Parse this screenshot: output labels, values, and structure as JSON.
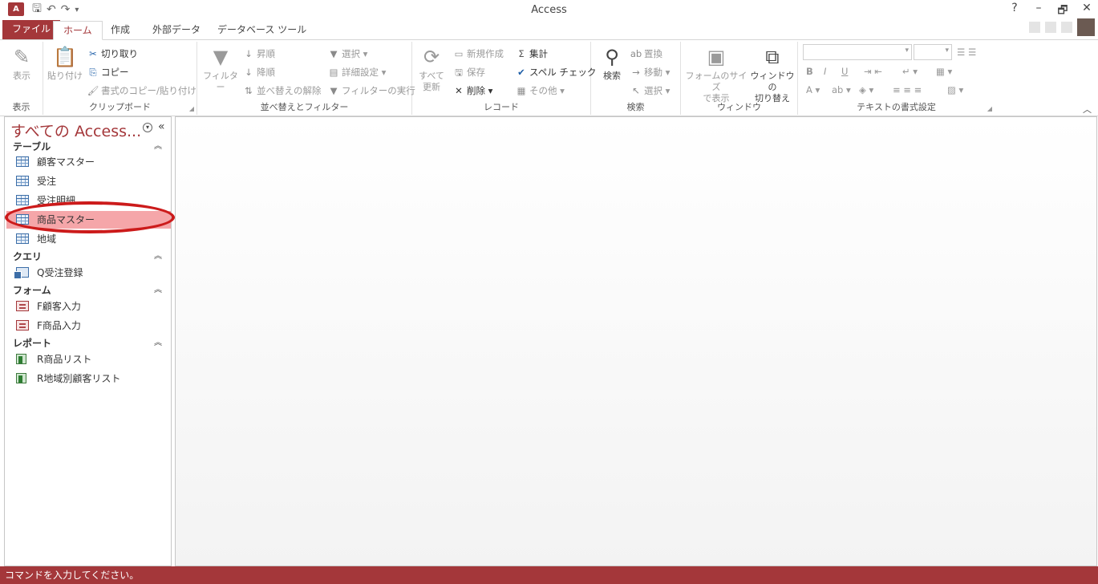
{
  "app": {
    "icon_label": "A",
    "window_title": "Access",
    "qat": {
      "save": "🖫",
      "undo": "↶",
      "redo": "↷",
      "customize": "▾"
    },
    "window_controls": {
      "help": "?",
      "minimize": "–",
      "restore": "🗗",
      "close": "✕"
    }
  },
  "tabs": {
    "file": "ファイル",
    "home": "ホーム",
    "create": "作成",
    "external": "外部データ",
    "dbtools": "データベース ツール"
  },
  "ribbon": {
    "views": {
      "label": "表示",
      "view_button": "表示"
    },
    "clipboard": {
      "label": "クリップボード",
      "paste": "貼り付け",
      "cut": "切り取り",
      "copy": "コピー",
      "format_painter": "書式のコピー/貼り付け"
    },
    "sort_filter": {
      "label": "並べ替えとフィルター",
      "filter": "フィルター",
      "ascending": "昇順",
      "descending": "降順",
      "clear_sort": "並べ替えの解除",
      "selection": "選択",
      "advanced": "詳細設定",
      "toggle_filter": "フィルターの実行"
    },
    "records": {
      "label": "レコード",
      "refresh_line1": "すべて",
      "refresh_line2": "更新",
      "new": "新規作成",
      "save": "保存",
      "delete": "削除",
      "totals": "集計",
      "spelling": "スペル チェック",
      "more": "その他"
    },
    "find": {
      "label": "検索",
      "find": "検索",
      "replace": "置換",
      "goto": "移動",
      "select": "選択"
    },
    "window": {
      "label": "ウィンドウ",
      "fit_form_line1": "フォームのサイズ",
      "fit_form_line2": "で表示",
      "switch_line1": "ウィンドウの",
      "switch_line2": "切り替え"
    },
    "text_format": {
      "label": "テキストの書式設定",
      "bold": "B",
      "italic": "I",
      "underline": "U",
      "font_color": "A"
    }
  },
  "nav": {
    "title": "すべての Access...",
    "menu_icon": "▾",
    "shutter": "«",
    "groups": [
      {
        "header": "テーブル",
        "items": [
          "顧客マスター",
          "受注",
          "受注明細",
          "商品マスター",
          "地域"
        ]
      },
      {
        "header": "クエリ",
        "items": [
          "Q受注登録"
        ]
      },
      {
        "header": "フォーム",
        "items": [
          "F顧客入力",
          "F商品入力"
        ]
      },
      {
        "header": "レポート",
        "items": [
          "R商品リスト",
          "R地域別顧客リスト"
        ]
      }
    ],
    "collapse_chevron": "︽"
  },
  "status": {
    "text": "コマンドを入力してください。"
  }
}
